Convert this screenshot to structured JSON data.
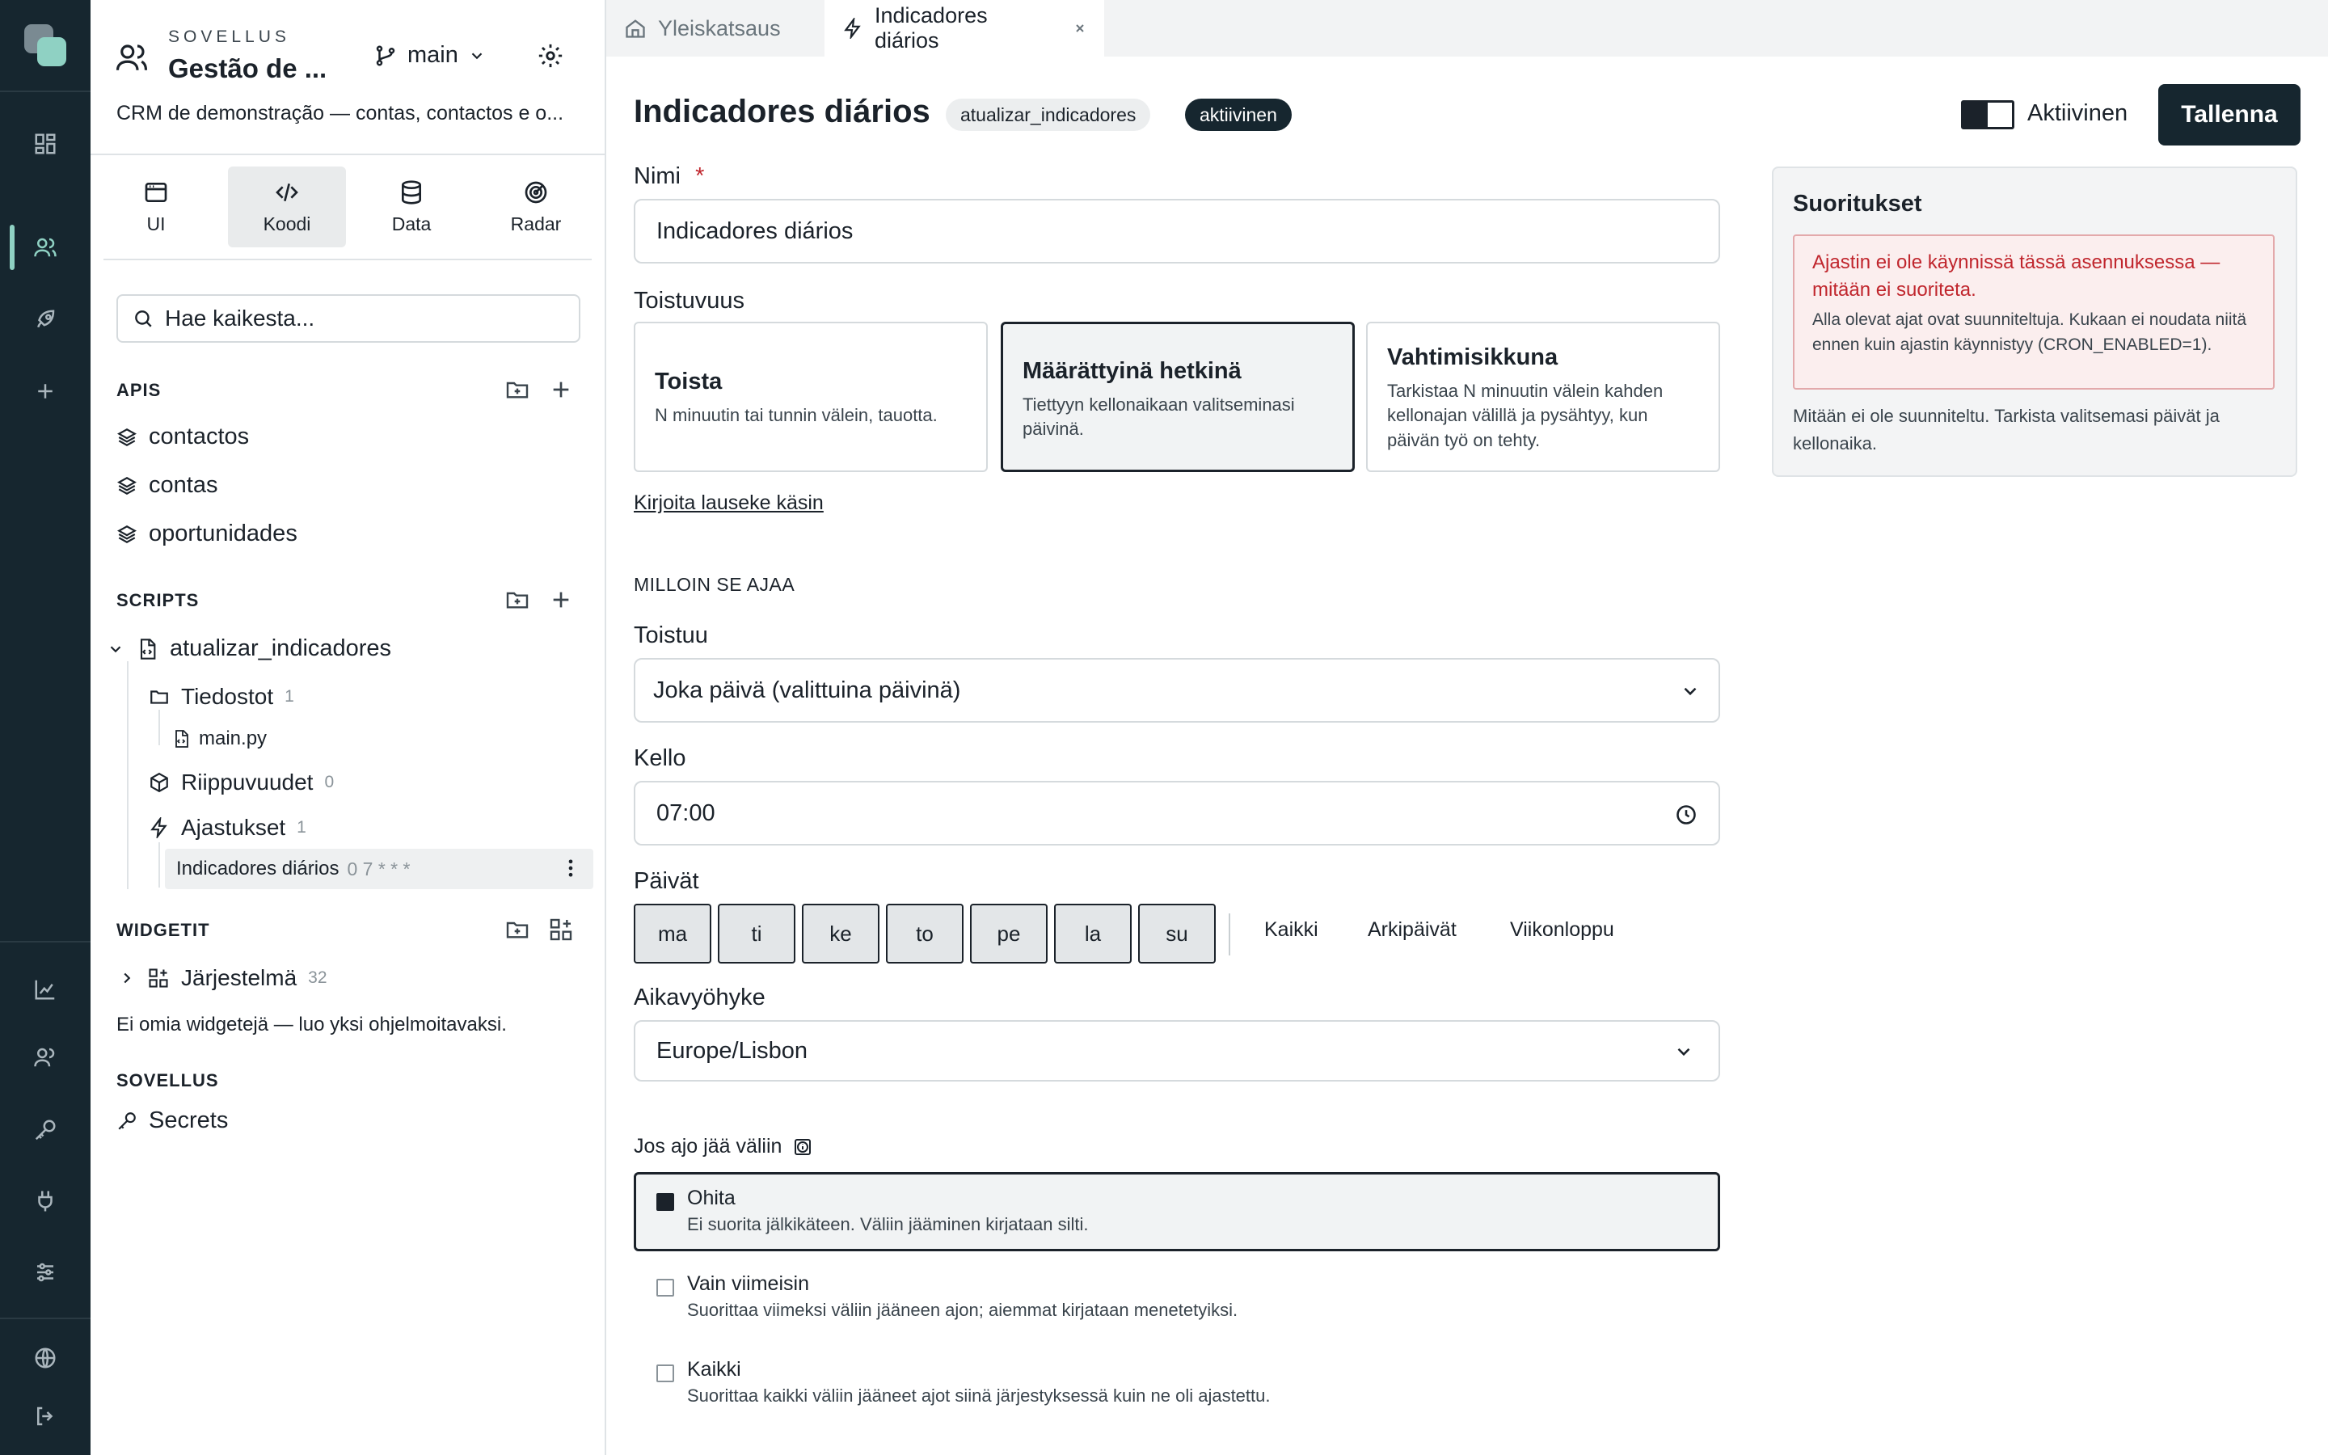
{
  "app": {
    "kicker": "SOVELLUS",
    "name": "Gestão de ...",
    "branch": "main",
    "description": "CRM de demonstração — contas, contactos e o..."
  },
  "modes": [
    {
      "label": "UI",
      "icon": "window-icon"
    },
    {
      "label": "Koodi",
      "icon": "code-icon"
    },
    {
      "label": "Data",
      "icon": "database-icon"
    },
    {
      "label": "Radar",
      "icon": "radar-icon"
    }
  ],
  "search": {
    "placeholder": "Hae kaikesta..."
  },
  "apis": {
    "title": "APIS",
    "items": [
      "contactos",
      "contas",
      "oportunidades"
    ]
  },
  "scripts": {
    "title": "SCRIPTS",
    "script_name": "atualizar_indicadores",
    "files_label": "Tiedostot",
    "files_count": "1",
    "file_name": "main.py",
    "deps_label": "Riippuvuudet",
    "deps_count": "0",
    "schedules_label": "Ajastukset",
    "schedules_count": "1",
    "schedule_item": "Indicadores diários",
    "schedule_cron": "0 7 * * *"
  },
  "widgets": {
    "title": "WIDGETIT",
    "system_label": "Järjestelmä",
    "system_count": "32",
    "empty_text": "Ei omia widgetejä — luo yksi ohjelmoitavaksi."
  },
  "sovellus": {
    "title": "SOVELLUS",
    "secrets_label": "Secrets"
  },
  "tabs": [
    {
      "label": "Yleiskatsaus"
    },
    {
      "label": "Indicadores diários"
    }
  ],
  "header": {
    "title": "Indicadores diários",
    "script_badge": "atualizar_indicadores",
    "status_badge": "aktiivinen",
    "toggle_label": "Aktiivinen",
    "save_label": "Tallenna"
  },
  "form": {
    "name_label": "Nimi",
    "required_mark": "*",
    "name_value": "Indicadores diários",
    "frequency_label": "Toistuvuus",
    "frequency_options": [
      {
        "title": "Toista",
        "desc": "N minuutin tai tunnin välein, tauotta."
      },
      {
        "title": "Määrättyinä hetkinä",
        "desc": "Tiettyyn kellonaikaan valitseminasi päivinä."
      },
      {
        "title": "Vahtimisikkuna",
        "desc": "Tarkistaa N minuutin välein kahden kellonajan välillä ja pysähtyy, kun päivän työ on tehty."
      }
    ],
    "manual_link": "Kirjoita lauseke käsin",
    "when_heading": "MILLOIN SE AJAA",
    "repeats_label": "Toistuu",
    "repeats_value": "Joka päivä (valittuina päivinä)",
    "clock_label": "Kello",
    "clock_value": "07:00",
    "days_label": "Päivät",
    "days": [
      "ma",
      "ti",
      "ke",
      "to",
      "pe",
      "la",
      "su"
    ],
    "quick": [
      "Kaikki",
      "Arkipäivät",
      "Viikonloppu"
    ],
    "tz_label": "Aikavyöhyke",
    "tz_value": "Europe/Lisbon",
    "missed_label": "Jos ajo jää väliin",
    "missed_options": [
      {
        "title": "Ohita",
        "desc": "Ei suorita jälkikäteen. Väliin jääminen kirjataan silti.",
        "selected": true
      },
      {
        "title": "Vain viimeisin",
        "desc": "Suorittaa viimeksi väliin jääneen ajon; aiemmat kirjataan menetetyiksi.",
        "selected": false
      },
      {
        "title": "Kaikki",
        "desc": "Suorittaa kaikki väliin jääneet ajot siinä järjestyksessä kuin ne oli ajastettu.",
        "selected": false
      }
    ]
  },
  "runs": {
    "title": "Suoritukset",
    "alert_title": "Ajastin ei ole käynnissä tässä asennuksessa — mitään ei suoriteta.",
    "alert_body": "Alla olevat ajat ovat suunniteltuja. Kukaan ei noudata niitä ennen kuin ajastin käynnistyy (CRON_ENABLED=1).",
    "empty_text": "Mitään ei ole suunniteltu. Tarkista valitsemasi päivät ja kellonaika."
  },
  "colors": {
    "rail_bg": "#16262f",
    "primary": "#16262f",
    "alert_bg": "#fbeeee",
    "alert_text": "#c0262d"
  }
}
